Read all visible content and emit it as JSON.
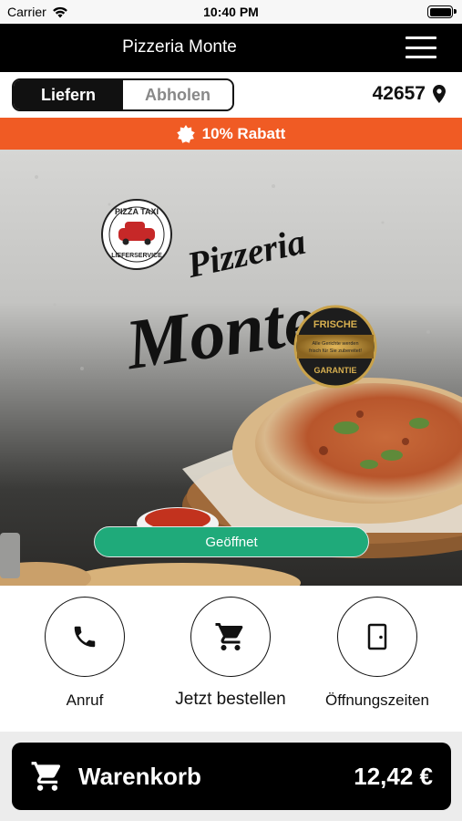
{
  "status_bar": {
    "carrier": "Carrier",
    "time": "10:40 PM"
  },
  "navbar": {
    "title": "Pizzeria Monte"
  },
  "delivery": {
    "deliver_label": "Liefern",
    "pickup_label": "Abholen",
    "zip": "42657"
  },
  "discount": {
    "label": "10% Rabatt"
  },
  "hero": {
    "logo_script": "Pizzeria",
    "logo_name": "Monte",
    "taxi_badge_top": "PIZZA TAXI",
    "taxi_badge_bottom": "LIEFERSERVICE",
    "seal_top": "FRISCHE",
    "seal_middle_1": "Alle Gerichte werden",
    "seal_middle_2": "frisch für Sie zubereitet!",
    "seal_bottom": "GARANTIE",
    "status_label": "Geöffnet"
  },
  "actions": [
    {
      "label": "Anruf",
      "icon": "phone-icon"
    },
    {
      "label": "Jetzt bestellen",
      "icon": "cart-icon"
    },
    {
      "label": "Öffnungszeiten",
      "icon": "door-icon"
    }
  ],
  "cart": {
    "label": "Warenkorb",
    "total": "12,42 €"
  },
  "colors": {
    "accent_orange": "#f05b24",
    "open_green": "#1faa7a",
    "dark": "#000000"
  }
}
